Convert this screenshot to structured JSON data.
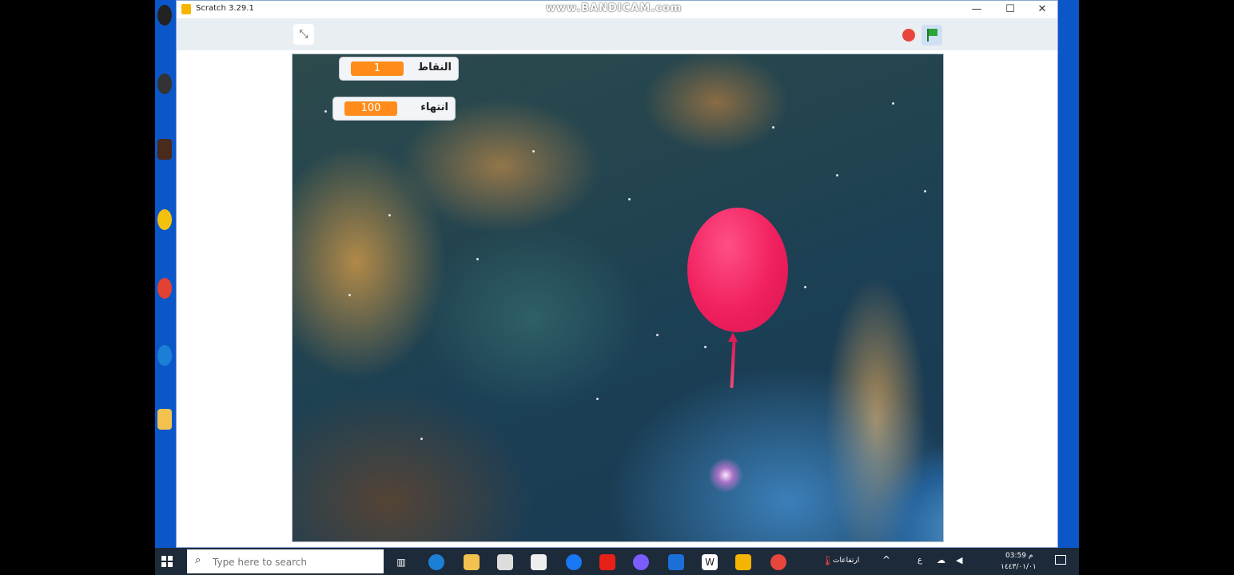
{
  "window": {
    "title": "Scratch 3.29.1",
    "watermark": "www.BANDICAM.com",
    "minimize_glyph": "—",
    "maximize_glyph": "☐",
    "close_glyph": "✕"
  },
  "toolbar": {
    "fullscreen_icon": "unfullscreen-icon",
    "stop_icon": "stop-icon",
    "flag_icon": "green-flag-icon"
  },
  "stage": {
    "monitors": [
      {
        "label": "النقاط",
        "value": "1"
      },
      {
        "label": "انتهاء",
        "value": "100"
      }
    ],
    "sprite": "balloon"
  },
  "taskbar": {
    "search_placeholder": "Type here to search",
    "tray_lang": "ع",
    "tray_label": "ارتفاعات",
    "clock_time": "03:59 م",
    "clock_date": "١٤٤٣/٠١/٠١"
  },
  "colors": {
    "monitor_value": "#ff8c1a",
    "stop": "#e8453c",
    "flag": "#2ca33b",
    "balloon": "#f0205e",
    "desktop": "#0b57c9",
    "taskbar": "#1d2a39"
  }
}
